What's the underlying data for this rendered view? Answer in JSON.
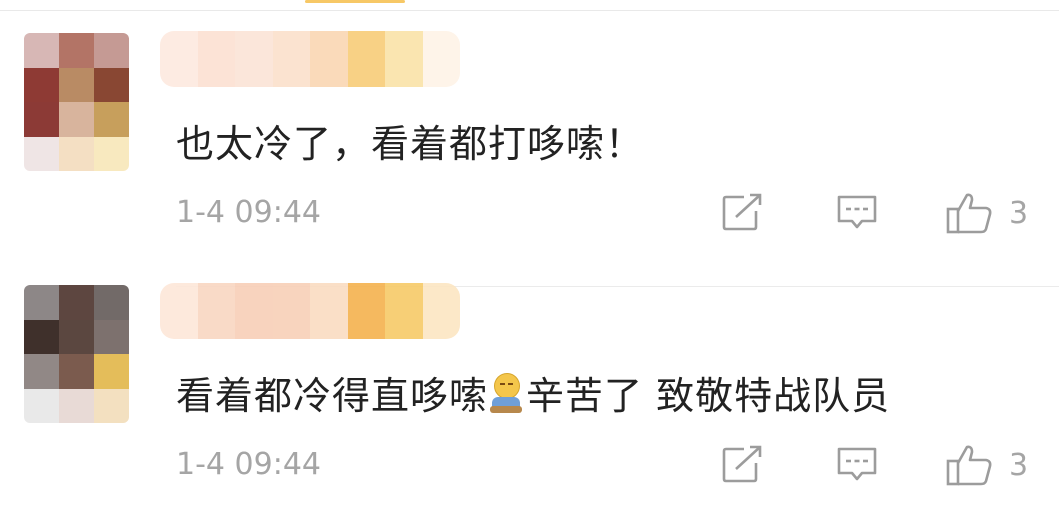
{
  "comments": [
    {
      "text": "也太冷了，看着都打哆嗦！",
      "timestamp": "1-4 09:44",
      "likes": "3",
      "avatar_pixels": [
        "#d7b7b5",
        "#b37466",
        "#c59a94",
        "#8e3a34",
        "#b98b64",
        "#894733",
        "#8c3a36",
        "#d8b49d",
        "#c79f5c",
        "#efe5e5",
        "#f4dfc3",
        "#f8e9bf"
      ],
      "name_pixels": [
        "#fde9df",
        "#fce0d2",
        "#fbe4d7",
        "#fbe0cc",
        "#fad6b3",
        "#f8cd78",
        "#fae3a8",
        "#fef3e7"
      ]
    },
    {
      "text_before_emoji": "看着都冷得直哆嗦",
      "text_after_emoji": "辛苦了 致敬特战队员",
      "timestamp": "1-4 09:44",
      "likes": "3",
      "avatar_pixels": [
        "#8d8787",
        "#5d4640",
        "#726a68",
        "#3f302b",
        "#5b4740",
        "#7d716e",
        "#918886",
        "#7b5b4e",
        "#e4bd5a",
        "#e9e9e9",
        "#e8dad6",
        "#f3e0c0"
      ],
      "name_pixels": [
        "#fde7d9",
        "#f9d7c2",
        "#f8cfb8",
        "#f8d0b8",
        "#fadcc1",
        "#f4b24e",
        "#f7ca68",
        "#fce6c3"
      ]
    }
  ]
}
